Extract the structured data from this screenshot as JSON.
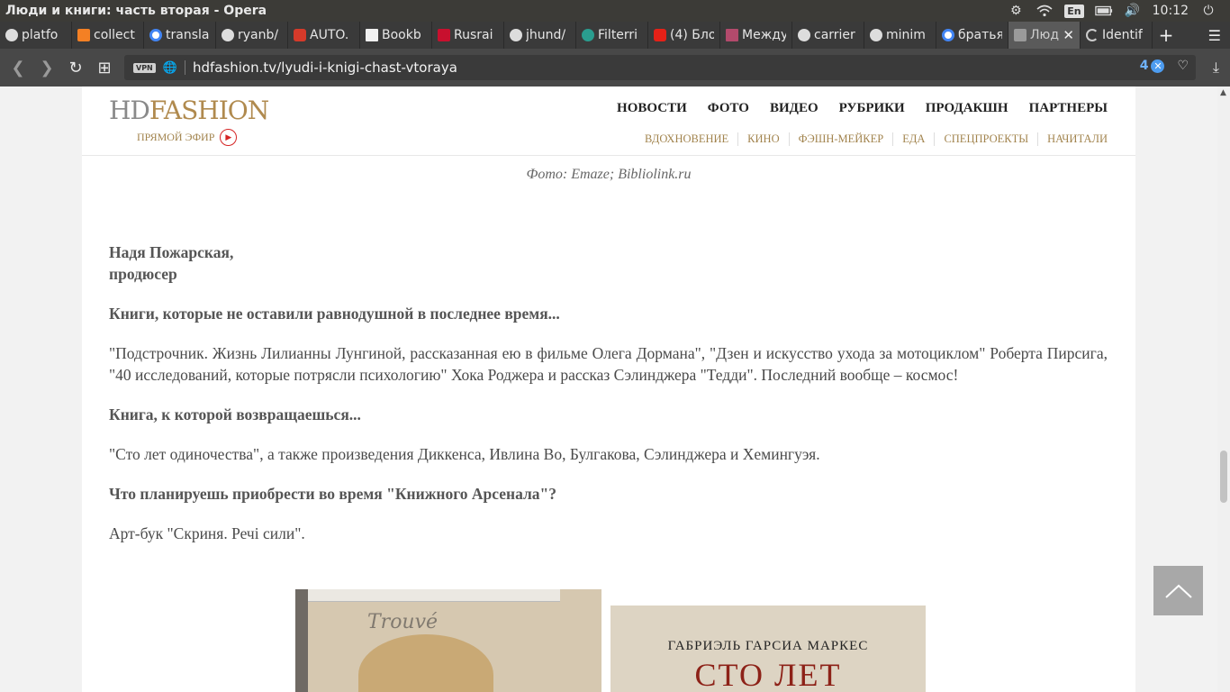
{
  "os": {
    "window_title": "Люди и книги: часть вторая - Opera",
    "lang": "En",
    "clock": "10:12"
  },
  "tabs": [
    {
      "label": "platfo",
      "icon": "github-icon"
    },
    {
      "label": "collect",
      "icon": "stackoverflow-icon"
    },
    {
      "label": "transla",
      "icon": "google-icon"
    },
    {
      "label": "ryanb/",
      "icon": "github-icon"
    },
    {
      "label": "AUTO.",
      "icon": "car-icon"
    },
    {
      "label": "Bookb",
      "icon": "document-icon"
    },
    {
      "label": "Rusrai",
      "icon": "rusrail-icon"
    },
    {
      "label": "jhund/",
      "icon": "github-icon"
    },
    {
      "label": "Filterri",
      "icon": "filter-icon"
    },
    {
      "label": "(4) Бло",
      "icon": "youtube-icon"
    },
    {
      "label": "Между",
      "icon": "book-icon"
    },
    {
      "label": "carrier",
      "icon": "github-icon"
    },
    {
      "label": "minim",
      "icon": "github-icon"
    },
    {
      "label": "братья",
      "icon": "google-icon"
    },
    {
      "label": "Люд",
      "icon": "hdfashion-icon"
    },
    {
      "label": "Identif",
      "icon": "loading-icon"
    }
  ],
  "address": {
    "vpn_label": "VPN",
    "url": "hdfashion.tv/lyudi-i-knigi-chast-vtoraya",
    "adblock_count": "4"
  },
  "site": {
    "logo_hd": "HD",
    "logo_fashion": "FASHION",
    "live_label": "ПРЯМОЙ ЭФИР",
    "main_nav": [
      "НОВОСТИ",
      "ФОТО",
      "ВИДЕО",
      "РУБРИКИ",
      "ПРОДАКШН",
      "ПАРТНЕРЫ"
    ],
    "sub_nav": [
      "ВДОХНОВЕНИЕ",
      "КИНО",
      "ФЭШН-МЕЙКЕР",
      "ЕДА",
      "СПЕЦПРОЕКТЫ",
      "НАЧИТАЛИ"
    ]
  },
  "article": {
    "photo_credit": "Фото: Emaze; Bibliolink.ru",
    "person_name": "Надя Пожарская,",
    "person_role": "продюсер",
    "q1": "Книги, которые не оставили равнодушной в последнее время...",
    "a1": "\"Подстрочник. Жизнь Лилианны Лунгиной, рассказанная ею в фильме Олега Дормана\", \"Дзен и искусство ухода за мотоциклом\" Роберта Пирсига, \"40 исследований, которые потрясли психологию\" Хока Роджера и рассказ Сэлинджера \"Тедди\". Последний вообще – космос!",
    "q2": "Книга, к которой возвращаешься...",
    "a2": "\"Сто лет одиночества\", а также произведения Диккенса, Ивлина Во, Булгакова, Сэлинджера и Хемингуэя.",
    "q3": "Что планируешь приобрести во время \"Книжного Арсенала\"?",
    "a3": "Арт-бук \"Скриня. Речі сили\"."
  },
  "books": {
    "book1_script": "Trouvé",
    "book2_author": "ГАБРИЭЛЬ ГАРСИА МАРКЕС",
    "book2_title": "СТО ЛЕТ"
  },
  "colors": {
    "accent_gold": "#a2844e",
    "live_red": "#d52525"
  }
}
